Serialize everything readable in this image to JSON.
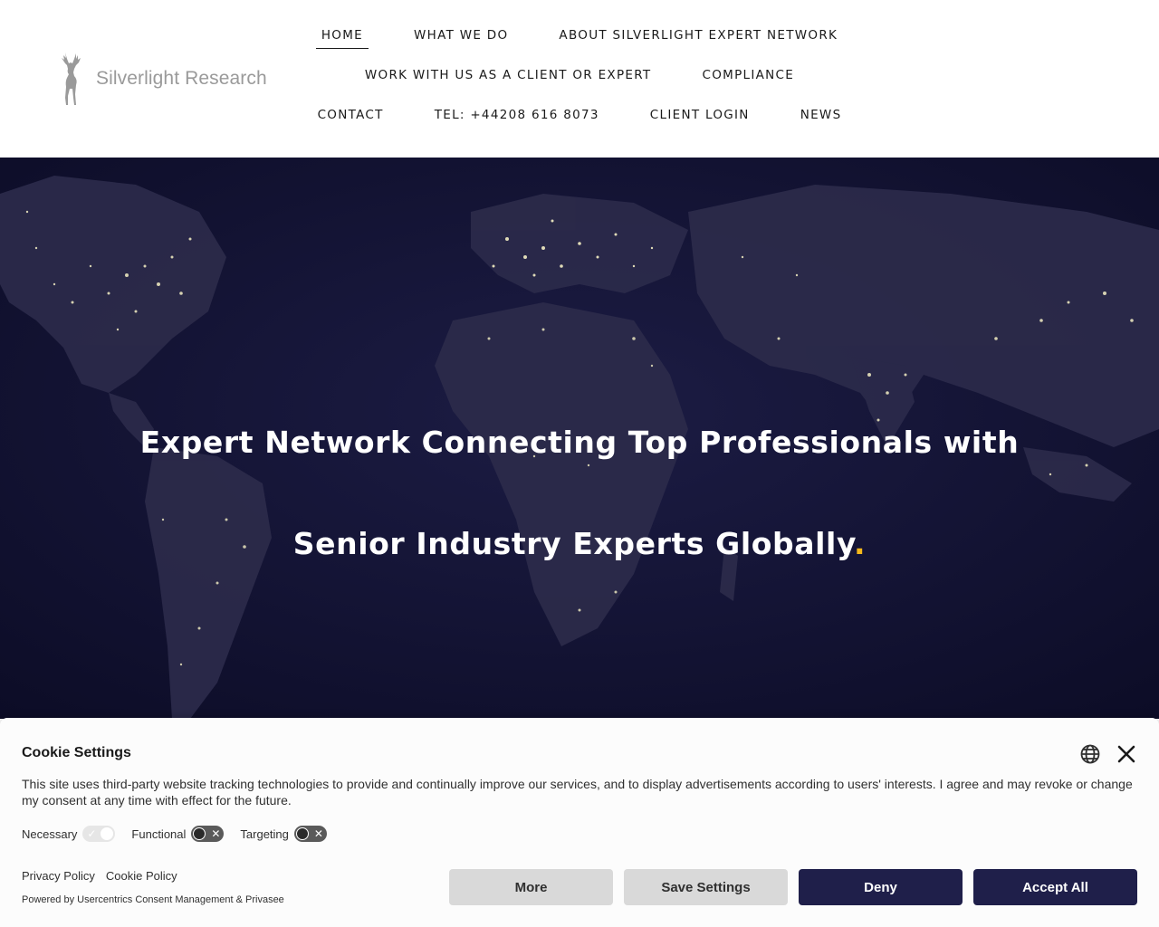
{
  "header": {
    "logo_text": "Silverlight Research",
    "nav": [
      [
        "HOME",
        "WHAT WE DO",
        "ABOUT SILVERLIGHT EXPERT NETWORK"
      ],
      [
        "WORK WITH US AS A CLIENT OR EXPERT",
        "COMPLIANCE"
      ],
      [
        "CONTACT",
        "TEL: +44208 616 8073",
        "CLIENT LOGIN",
        "NEWS"
      ]
    ],
    "active": "HOME"
  },
  "hero": {
    "line1": "Expert Network Connecting Top Professionals with",
    "line2": "Senior Industry Experts Globally",
    "accent": "."
  },
  "cookie": {
    "title": "Cookie Settings",
    "description": "This site uses third-party website tracking technologies to provide and continually improve our services, and to display advertisements according to users' interests. I agree and may revoke or change my consent at any time with effect for the future.",
    "toggles": {
      "necessary": "Necessary",
      "functional": "Functional",
      "targeting": "Targeting"
    },
    "links": {
      "privacy": "Privacy Policy",
      "cookie": "Cookie Policy"
    },
    "powered": "Powered by Usercentrics Consent Management & Privasee",
    "buttons": {
      "more": "More",
      "save": "Save Settings",
      "deny": "Deny",
      "accept": "Accept All"
    },
    "icons": {
      "language": "globe-icon",
      "close": "close-icon"
    }
  },
  "colors": {
    "hero_bg": "#0f0f2e",
    "accent": "#f5b81b",
    "button_dark": "#1f1f4a"
  }
}
